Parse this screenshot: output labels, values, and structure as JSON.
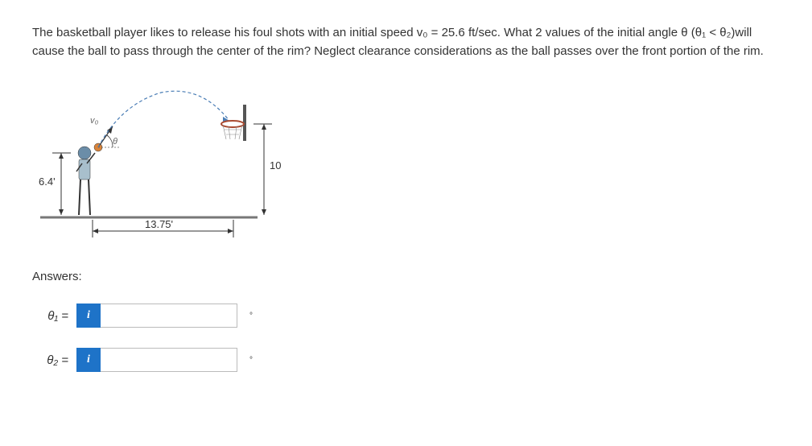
{
  "problem": {
    "text": "The basketball player likes to release his foul shots with an initial speed v₀ = 25.6 ft/sec. What 2 values of the initial angle θ (θ₁ < θ₂)will cause the ball to pass through the center of the rim? Neglect clearance considerations as the ball passes over the front portion of the rim."
  },
  "diagram": {
    "v0_label": "v₀",
    "theta_label": "θ",
    "release_height": "6.4'",
    "rim_height": "10'",
    "horizontal_distance": "13.75'"
  },
  "answers": {
    "title": "Answers:",
    "theta1_label": "θ₁ =",
    "theta2_label": "θ₂ =",
    "info_symbol": "i",
    "unit_symbol": "°",
    "theta1_value": "",
    "theta2_value": ""
  }
}
